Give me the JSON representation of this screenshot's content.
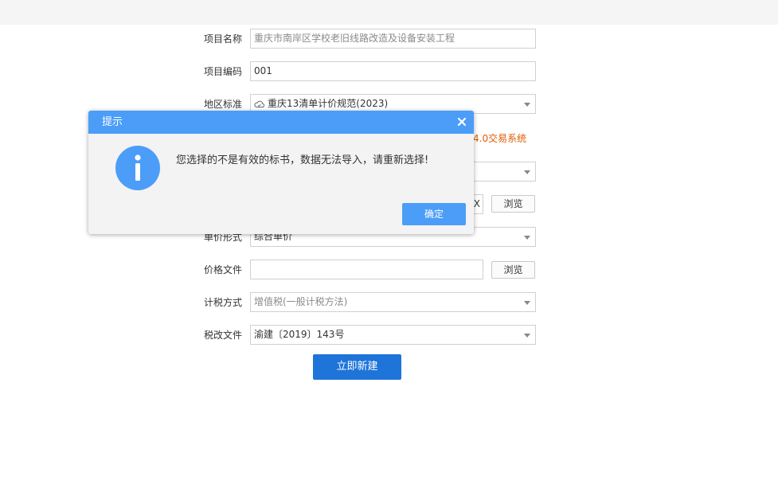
{
  "form": {
    "project_name": {
      "label": "项目名称",
      "value": "重庆市南岸区学校老旧线路改造及设备安装工程"
    },
    "project_code": {
      "label": "项目编码",
      "value": "001"
    },
    "region_standard": {
      "label": "地区标准",
      "value": "重庆13清单计价规范(2023)"
    },
    "hint_text": "4.0交易系统",
    "hidden_input_fragment": "X",
    "unit_price_form": {
      "label": "单价形式",
      "value": "综合单价"
    },
    "price_file": {
      "label": "价格文件",
      "value": ""
    },
    "tax_method": {
      "label": "计税方式",
      "value": "增值税(一般计税方法)"
    },
    "tax_reform_file": {
      "label": "税改文件",
      "value": "渝建〔2019〕143号"
    },
    "browse_label": "浏览",
    "submit_label": "立即新建"
  },
  "modal": {
    "title": "提示",
    "message": "您选择的不是有效的标书，数据无法导入，请重新选择!",
    "ok_label": "确定"
  },
  "colors": {
    "accent": "#4b9df8",
    "primary_button": "#1e74d9",
    "hint": "#e05a00"
  },
  "icons": [
    "cloud-icon",
    "close-icon",
    "info-icon",
    "chevron-down-icon"
  ]
}
